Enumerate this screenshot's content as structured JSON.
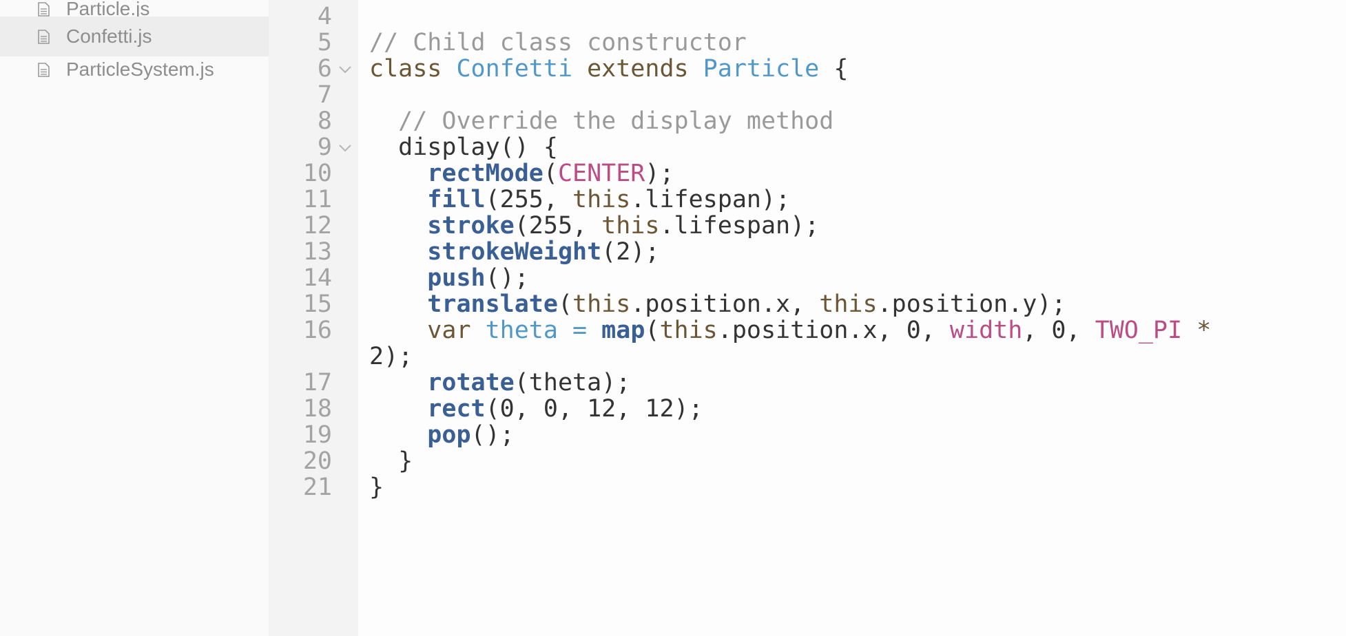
{
  "sidebar": {
    "files": [
      {
        "name": "Particle.js",
        "active": false
      },
      {
        "name": "Confetti.js",
        "active": true
      },
      {
        "name": "ParticleSystem.js",
        "active": false
      }
    ]
  },
  "editor": {
    "line_numbers": [
      "4",
      "5",
      "6",
      "7",
      "8",
      "9",
      "10",
      "11",
      "12",
      "13",
      "14",
      "15",
      "16",
      "17",
      "18",
      "19",
      "20",
      "21"
    ],
    "fold_markers_on_lines": [
      "6",
      "9"
    ],
    "lines": [
      [],
      [
        {
          "t": "// Child class constructor",
          "c": "cmt"
        }
      ],
      [
        {
          "t": "class ",
          "c": "kw"
        },
        {
          "t": "Confetti",
          "c": "cls"
        },
        {
          "t": " extends ",
          "c": "kw"
        },
        {
          "t": "Particle",
          "c": "cls"
        },
        {
          "t": " {",
          "c": "pl"
        }
      ],
      [],
      [
        {
          "t": "  ",
          "c": "pl"
        },
        {
          "t": "// Override the display method",
          "c": "cmt"
        }
      ],
      [
        {
          "t": "  display() {",
          "c": "pl"
        }
      ],
      [
        {
          "t": "    ",
          "c": "pl"
        },
        {
          "t": "rectMode",
          "c": "fn"
        },
        {
          "t": "(",
          "c": "pl"
        },
        {
          "t": "CENTER",
          "c": "cst"
        },
        {
          "t": ");",
          "c": "pl"
        }
      ],
      [
        {
          "t": "    ",
          "c": "pl"
        },
        {
          "t": "fill",
          "c": "fn"
        },
        {
          "t": "(255, ",
          "c": "pl"
        },
        {
          "t": "this",
          "c": "kw"
        },
        {
          "t": ".lifespan);",
          "c": "pl"
        }
      ],
      [
        {
          "t": "    ",
          "c": "pl"
        },
        {
          "t": "stroke",
          "c": "fn"
        },
        {
          "t": "(255, ",
          "c": "pl"
        },
        {
          "t": "this",
          "c": "kw"
        },
        {
          "t": ".lifespan);",
          "c": "pl"
        }
      ],
      [
        {
          "t": "    ",
          "c": "pl"
        },
        {
          "t": "strokeWeight",
          "c": "fn"
        },
        {
          "t": "(2);",
          "c": "pl"
        }
      ],
      [
        {
          "t": "    ",
          "c": "pl"
        },
        {
          "t": "push",
          "c": "fn"
        },
        {
          "t": "();",
          "c": "pl"
        }
      ],
      [
        {
          "t": "    ",
          "c": "pl"
        },
        {
          "t": "translate",
          "c": "fn"
        },
        {
          "t": "(",
          "c": "pl"
        },
        {
          "t": "this",
          "c": "kw"
        },
        {
          "t": ".position.x, ",
          "c": "pl"
        },
        {
          "t": "this",
          "c": "kw"
        },
        {
          "t": ".position.y);",
          "c": "pl"
        }
      ],
      [
        {
          "t": "    ",
          "c": "pl"
        },
        {
          "t": "var ",
          "c": "kw"
        },
        {
          "t": "theta",
          "c": "var"
        },
        {
          "t": " = ",
          "c": "op"
        },
        {
          "t": "map",
          "c": "fn"
        },
        {
          "t": "(",
          "c": "pl"
        },
        {
          "t": "this",
          "c": "kw"
        },
        {
          "t": ".position.x, 0, ",
          "c": "pl"
        },
        {
          "t": "width",
          "c": "cst"
        },
        {
          "t": ", 0, ",
          "c": "pl"
        },
        {
          "t": "TWO_PI",
          "c": "cst"
        },
        {
          "t": " *",
          "c": "kw"
        }
      ],
      [
        {
          "t": "2);",
          "c": "pl"
        }
      ],
      [
        {
          "t": "    ",
          "c": "pl"
        },
        {
          "t": "rotate",
          "c": "fn"
        },
        {
          "t": "(theta);",
          "c": "pl"
        }
      ],
      [
        {
          "t": "    ",
          "c": "pl"
        },
        {
          "t": "rect",
          "c": "fn"
        },
        {
          "t": "(0, 0, 12, 12);",
          "c": "pl"
        }
      ],
      [
        {
          "t": "    ",
          "c": "pl"
        },
        {
          "t": "pop",
          "c": "fn"
        },
        {
          "t": "();",
          "c": "pl"
        }
      ],
      [
        {
          "t": "  }",
          "c": "pl"
        }
      ],
      [
        {
          "t": "}",
          "c": "pl"
        }
      ]
    ]
  }
}
